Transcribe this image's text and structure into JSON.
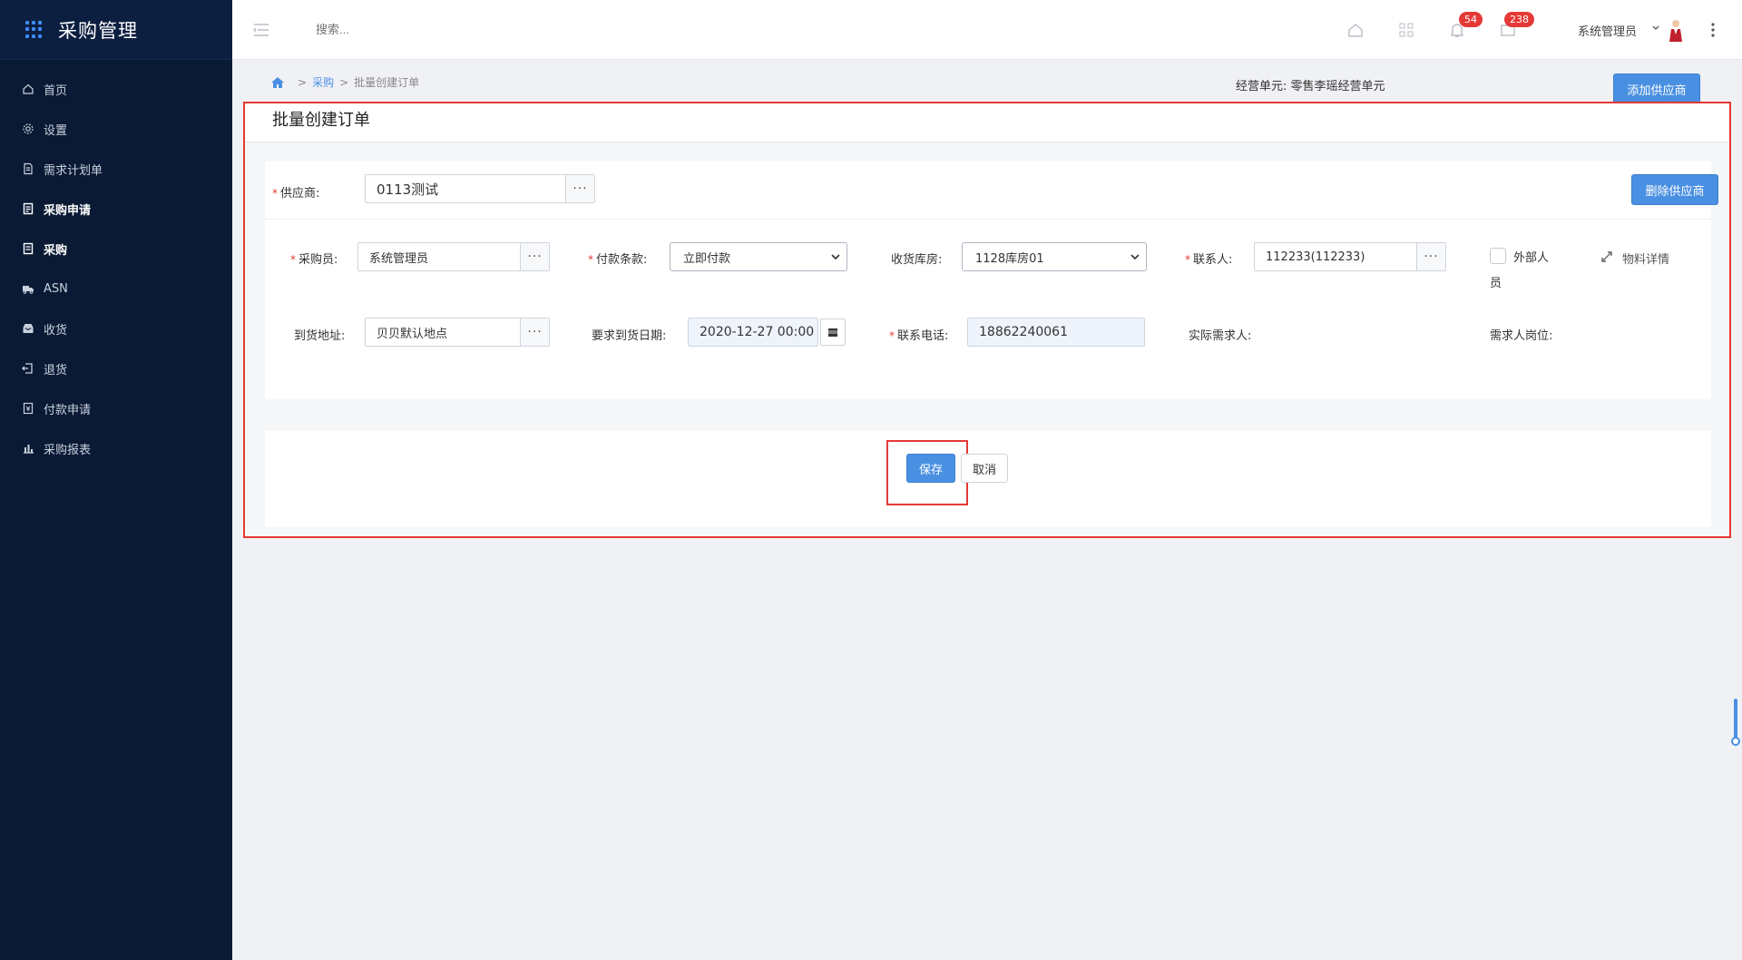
{
  "app": {
    "title": "采购管理"
  },
  "menu": [
    {
      "label": "首页",
      "icon": "home-icon",
      "bold": false
    },
    {
      "label": "设置",
      "icon": "gear-icon",
      "bold": false
    },
    {
      "label": "需求计划单",
      "icon": "document-icon",
      "bold": false
    },
    {
      "label": "采购申请",
      "icon": "list-icon",
      "bold": true
    },
    {
      "label": "采购",
      "icon": "clipboard-icon",
      "bold": true
    },
    {
      "label": "ASN",
      "icon": "truck-icon",
      "bold": false
    },
    {
      "label": "收货",
      "icon": "inbox-icon",
      "bold": false
    },
    {
      "label": "退货",
      "icon": "return-icon",
      "bold": false
    },
    {
      "label": "付款申请",
      "icon": "payment-icon",
      "bold": false
    },
    {
      "label": "采购报表",
      "icon": "bar-chart-icon",
      "bold": false
    }
  ],
  "topbar": {
    "search_placeholder": "搜索...",
    "notifications_count": "54",
    "messages_count": "238",
    "user_name": "系统管理员"
  },
  "breadcrumb": {
    "level1": "采购",
    "current": "批量创建订单"
  },
  "business_unit": {
    "label": "经营单元:",
    "value": "零售李瑶经营单元"
  },
  "add_supplier_label": "添加供应商",
  "panel": {
    "title": "批量创建订单"
  },
  "supplier": {
    "label": "供应商:",
    "value": "0113测试",
    "delete_label": "删除供应商"
  },
  "form": {
    "buyer": {
      "label": "采购员:",
      "value": "系统管理员"
    },
    "payment_terms": {
      "label": "付款条款:",
      "value": "立即付款"
    },
    "warehouse": {
      "label": "收货库房:",
      "value": "1128库房01"
    },
    "contact": {
      "label": "联系人:",
      "value": "112233(112233)"
    },
    "external": {
      "label_line1": "外部人",
      "label_line2": "员"
    },
    "material_detail": "物料详情",
    "address": {
      "label": "到货地址:",
      "value": "贝贝默认地点"
    },
    "arrival_date": {
      "label": "要求到货日期:",
      "value": "2020-12-27 00:00"
    },
    "phone": {
      "label": "联系电话:",
      "value": "18862240061"
    },
    "requester": {
      "label": "实际需求人:"
    },
    "requester_position": {
      "label": "需求人岗位:"
    }
  },
  "actions": {
    "save": "保存",
    "cancel": "取消"
  },
  "colors": {
    "sidebar": "#0a1a35",
    "primary": "#4a90e2",
    "highlight_border": "#e53935"
  }
}
